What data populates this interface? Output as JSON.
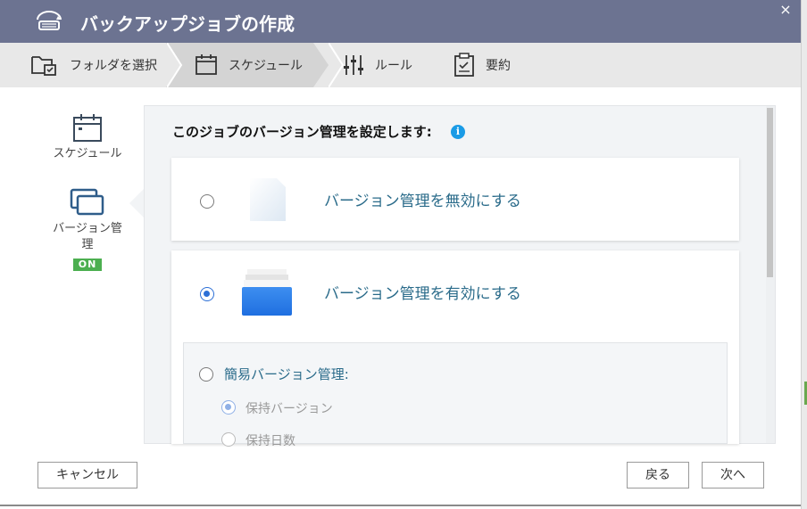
{
  "window": {
    "title": "バックアップジョブの作成",
    "close_glyph": "×"
  },
  "steps": [
    {
      "label": "フォルダを選択",
      "icon": "folder-select-icon"
    },
    {
      "label": "スケジュール",
      "icon": "calendar-icon",
      "active": true
    },
    {
      "label": "ルール",
      "icon": "sliders-icon"
    },
    {
      "label": "要約",
      "icon": "clipboard-check-icon"
    }
  ],
  "sidebar": {
    "items": [
      {
        "label": "スケジュール",
        "icon": "calendar-icon"
      },
      {
        "label_line1": "バージョン管",
        "label_line2": "理",
        "icon": "versions-icon",
        "badge": "ON"
      }
    ]
  },
  "main": {
    "heading": "このジョブのバージョン管理を設定します:",
    "info_glyph": "i",
    "options": [
      {
        "label": "バージョン管理を無効にする",
        "selected": false
      },
      {
        "label": "バージョン管理を有効にする",
        "selected": true
      }
    ],
    "sub": {
      "label": "簡易バージョン管理:",
      "selected": false,
      "choices": [
        {
          "label": "保持バージョン",
          "selected": true
        },
        {
          "label": "保持日数",
          "selected": false
        }
      ]
    }
  },
  "footer": {
    "cancel_label": "キャンセル",
    "back_label": "戻る",
    "next_label": "次へ"
  },
  "colors": {
    "titlebar": "#6c7391",
    "accent": "#2c6fd6",
    "option_text": "#2a6b8a",
    "badge": "#4caf50"
  }
}
